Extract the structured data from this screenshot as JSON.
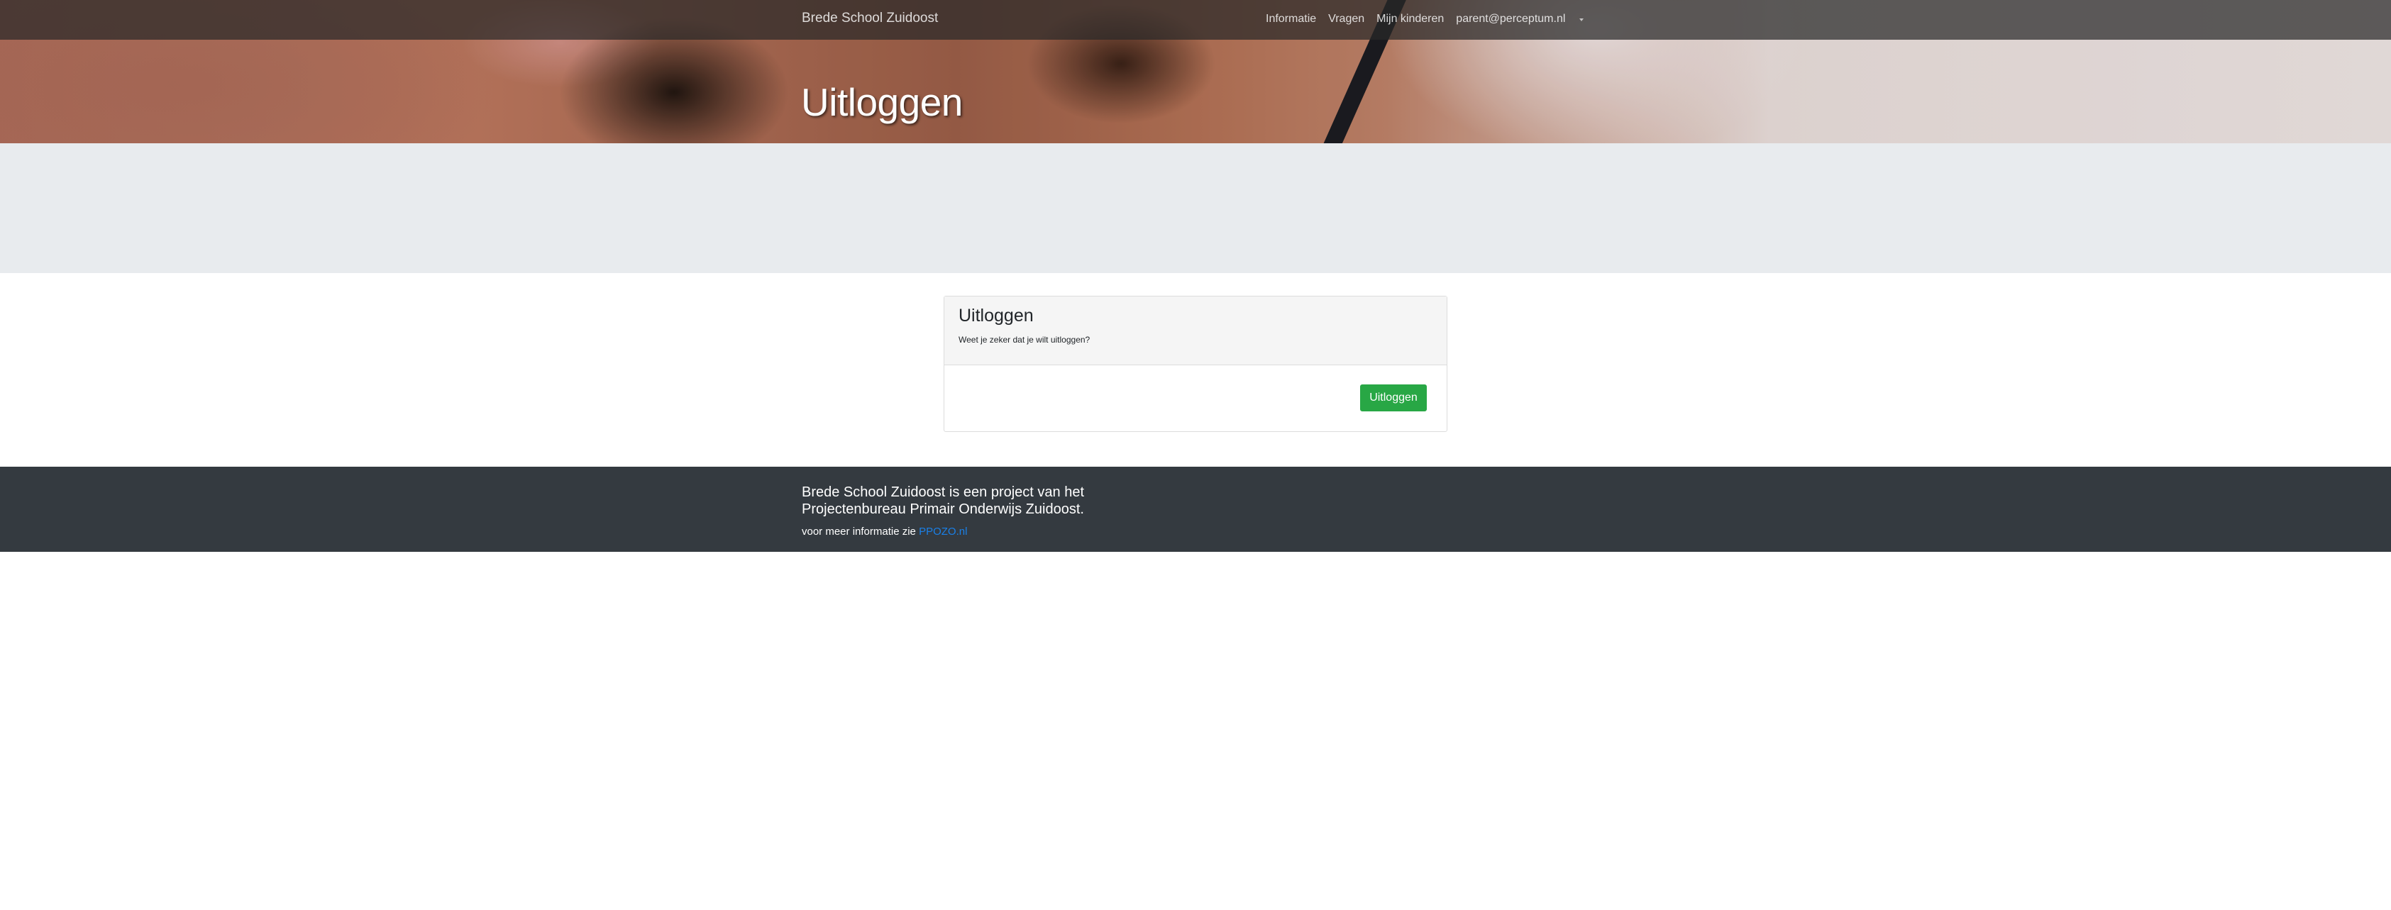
{
  "navbar": {
    "brand": "Brede School Zuidoost",
    "links": [
      {
        "label": "Informatie"
      },
      {
        "label": "Vragen"
      },
      {
        "label": "Mijn kinderen"
      }
    ],
    "user_menu": {
      "label": "parent@perceptum.nl",
      "icon": "caret-down-icon"
    }
  },
  "hero": {
    "title": "Uitloggen"
  },
  "card": {
    "title": "Uitloggen",
    "subtitle": "Weet je zeker dat je wilt uitloggen?",
    "button_label": "Uitloggen"
  },
  "footer": {
    "text": "Brede School Zuidoost is een project van het Projectenbureau Primair Onderwijs Zuidoost.",
    "more_prefix": "voor meer informatie zie",
    "link_label": "PPOZO.nl"
  },
  "colors": {
    "navbar_bg": "#282828",
    "grey_band": "#e8ebee",
    "button_green": "#28a745",
    "footer_bg": "#343a40",
    "link_blue": "#1a80e8"
  }
}
